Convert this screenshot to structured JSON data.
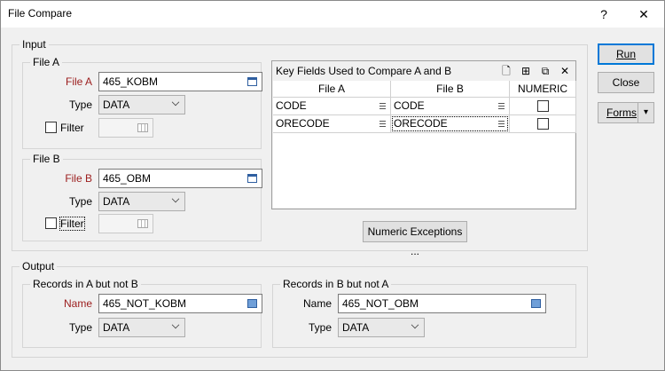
{
  "window": {
    "title": "File Compare",
    "help_glyph": "?",
    "close_glyph": "✕"
  },
  "input": {
    "legend": "Input",
    "file_a": {
      "legend": "File A",
      "file_label": "File A",
      "file_value": "465_KOBM",
      "type_label": "Type",
      "type_value": "DATA",
      "filter_label": "Filter",
      "filter_checked": false
    },
    "file_b": {
      "legend": "File B",
      "file_label": "File B",
      "file_value": "465_OBM",
      "type_label": "Type",
      "type_value": "DATA",
      "filter_label": "Filter",
      "filter_checked": false
    }
  },
  "key_fields": {
    "title": "Key Fields Used to Compare A and B",
    "columns": [
      "File A",
      "File B",
      "NUMERIC"
    ],
    "rows": [
      {
        "a": "CODE",
        "b": "CODE",
        "numeric": false
      },
      {
        "a": "ORECODE",
        "b": "ORECODE",
        "numeric": false
      }
    ],
    "numeric_exceptions_label": "Numeric Exceptions ..."
  },
  "output": {
    "legend": "Output",
    "a_not_b": {
      "legend": "Records in A but not B",
      "name_label": "Name",
      "name_value": "465_NOT_KOBM",
      "type_label": "Type",
      "type_value": "DATA"
    },
    "b_not_a": {
      "legend": "Records in B but not A",
      "name_label": "Name",
      "name_value": "465_NOT_OBM",
      "type_label": "Type",
      "type_value": "DATA"
    }
  },
  "buttons": {
    "run": "Run",
    "close": "Close",
    "forms": "Forms",
    "forms_arrow": "▾"
  }
}
